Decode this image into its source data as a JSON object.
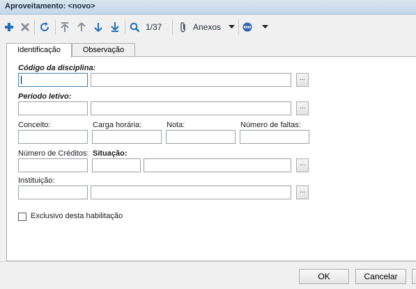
{
  "window": {
    "title": "Aproveitamento: <novo>"
  },
  "toolbar": {
    "record_counter": "1/37",
    "attachments_label": "Anexos",
    "icons": [
      "add-icon",
      "delete-icon",
      "refresh-icon",
      "first-record-icon",
      "previous-record-icon",
      "next-record-icon",
      "last-record-icon",
      "search-icon",
      "paperclip-icon",
      "options-icon"
    ]
  },
  "tabs": [
    {
      "label": "Identificação",
      "active": true
    },
    {
      "label": "Observação",
      "active": false
    }
  ],
  "form": {
    "codigo_label": "Código da disciplina:",
    "periodo_label": "Período letivo:",
    "conceito_label": "Conceito:",
    "carga_label": "Carga horária:",
    "nota_label": "Nota:",
    "faltas_label": "Número de faltas:",
    "creditos_label": "Número de Créditos:",
    "situacao_label": "Situação:",
    "instituicao_label": "Instituição:",
    "lookup_label": "...",
    "exclusivo_label": "Exclusivo desta habilitação",
    "exclusivo_checked": false
  },
  "footer": {
    "ok_label": "OK",
    "cancel_label": "Cancelar"
  },
  "colors": {
    "accent": "#1f6fb5",
    "title_bg": "#d9e4f1"
  }
}
